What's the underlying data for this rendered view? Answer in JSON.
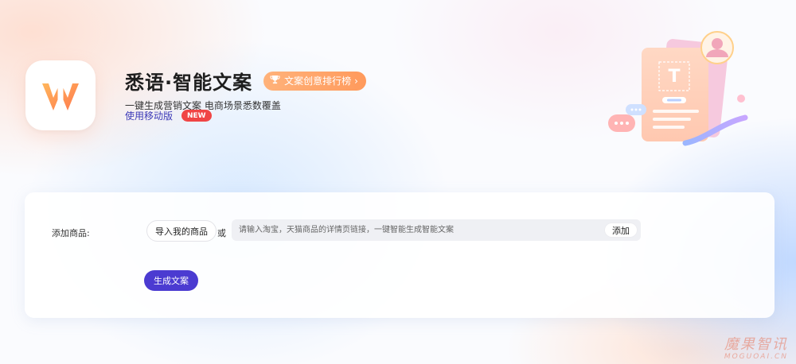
{
  "header": {
    "title": "悉语·智能文案",
    "rank_badge": "文案创意排行榜",
    "subtitle": "一键生成营销文案 电商场景悉数覆盖",
    "mobile_link": "使用移动版",
    "new_badge": "NEW"
  },
  "form": {
    "product_label": "添加商品:",
    "import_button": "导入我的商品",
    "or_text": "或",
    "link_placeholder": "请输入淘宝，天猫商品的详情页链接，一键智能生成智能文案",
    "add_button": "添加",
    "generate_button": "生成文案"
  },
  "watermark": {
    "cn": "魔果智讯",
    "en": "MOGUOAI.CN"
  },
  "colors": {
    "brand_orange": "#ff9a5c",
    "primary_purple": "#4b3bd1",
    "link_purple": "#3d3ab8",
    "new_red": "#f04545"
  },
  "icons": [
    "app-logo-icon",
    "trophy-icon",
    "chevron-right-icon",
    "document-illustration"
  ]
}
